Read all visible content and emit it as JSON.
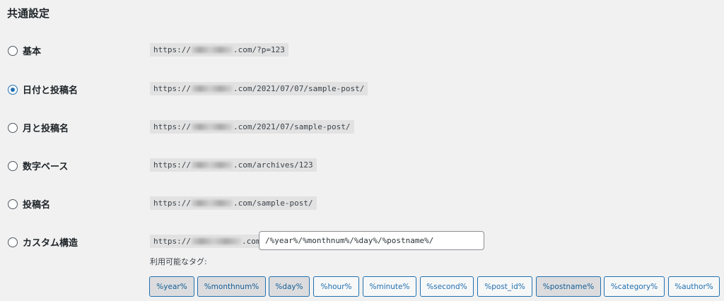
{
  "section_title": "共通設定",
  "options": [
    {
      "label": "基本",
      "prefix": "https://",
      "suffix": ".com/?p=123",
      "checked": false
    },
    {
      "label": "日付と投稿名",
      "prefix": "https://",
      "suffix": ".com/2021/07/07/sample-post/",
      "checked": true
    },
    {
      "label": "月と投稿名",
      "prefix": "https://",
      "suffix": ".com/2021/07/sample-post/",
      "checked": false
    },
    {
      "label": "数字ベース",
      "prefix": "https://",
      "suffix": ".com/archives/123",
      "checked": false
    },
    {
      "label": "投稿名",
      "prefix": "https://",
      "suffix": ".com/sample-post/",
      "checked": false
    },
    {
      "label": "カスタム構造",
      "prefix": "https://",
      "suffix": ".com",
      "checked": false
    }
  ],
  "custom_structure_value": "/%year%/%monthnum%/%day%/%postname%/",
  "tags_label": "利用可能なタグ:",
  "tags": [
    {
      "label": "%year%",
      "active": true
    },
    {
      "label": "%monthnum%",
      "active": true
    },
    {
      "label": "%day%",
      "active": true
    },
    {
      "label": "%hour%",
      "active": false
    },
    {
      "label": "%minute%",
      "active": false
    },
    {
      "label": "%second%",
      "active": false
    },
    {
      "label": "%post_id%",
      "active": false
    },
    {
      "label": "%postname%",
      "active": true
    },
    {
      "label": "%category%",
      "active": false
    },
    {
      "label": "%author%",
      "active": false
    }
  ],
  "colors": {
    "accent": "#2271b1",
    "code_bg": "#e2e2e2",
    "page_bg": "#f1f1f1"
  }
}
